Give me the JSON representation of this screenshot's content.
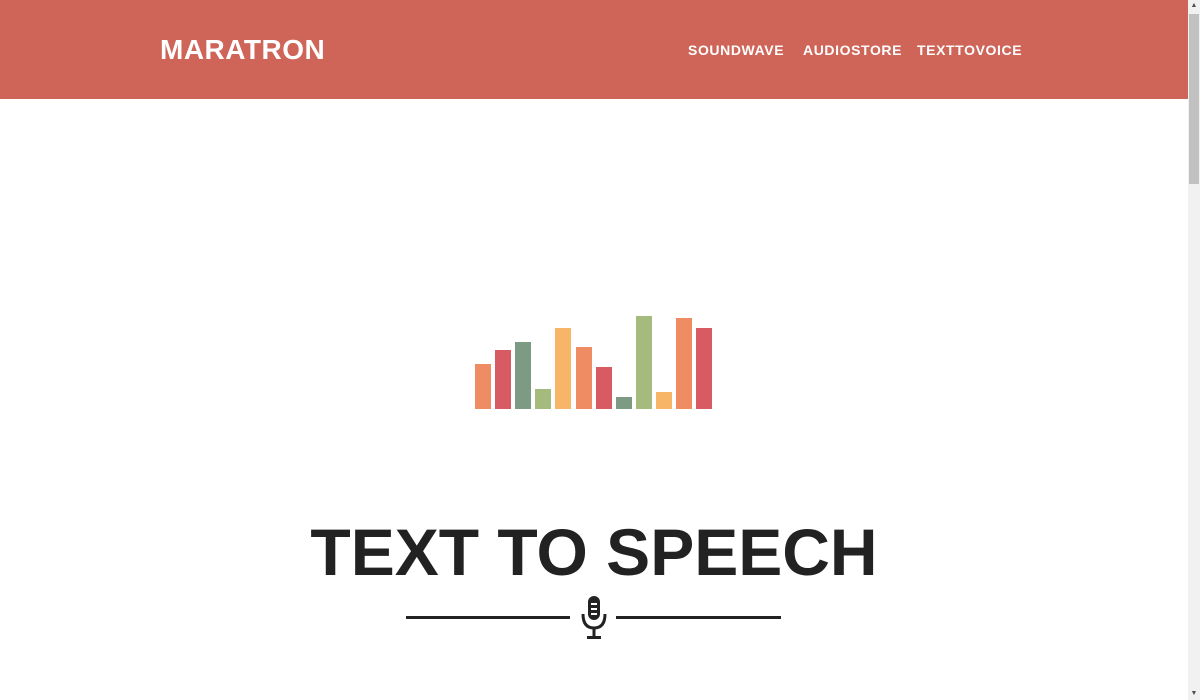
{
  "navbar": {
    "brand": "MARATRON",
    "links": [
      "SOUNDWAVE",
      "AUDIOSTORE",
      "TEXTTOVOICE"
    ],
    "background_color": "#cf6558"
  },
  "hero": {
    "bars": [
      {
        "level": 0.48,
        "color": "#f08c64"
      },
      {
        "level": 0.63,
        "color": "#d85a63"
      },
      {
        "level": 0.72,
        "color": "#7d9a83"
      },
      {
        "level": 0.22,
        "color": "#a4bb7d"
      },
      {
        "level": 0.87,
        "color": "#f7b567"
      },
      {
        "level": 0.67,
        "color": "#f08c64"
      },
      {
        "level": 0.45,
        "color": "#d85a63"
      },
      {
        "level": 0.13,
        "color": "#7d9a83"
      },
      {
        "level": 1.0,
        "color": "#a4bb7d"
      },
      {
        "level": 0.18,
        "color": "#f7b567"
      },
      {
        "level": 0.98,
        "color": "#f08c64"
      },
      {
        "level": 0.87,
        "color": "#d85a63"
      }
    ],
    "title": "TEXT TO SPEECH",
    "divider_icon": "microphone-icon"
  },
  "scrollbar": {
    "up_arrow": "▲",
    "down_arrow": "▼"
  }
}
